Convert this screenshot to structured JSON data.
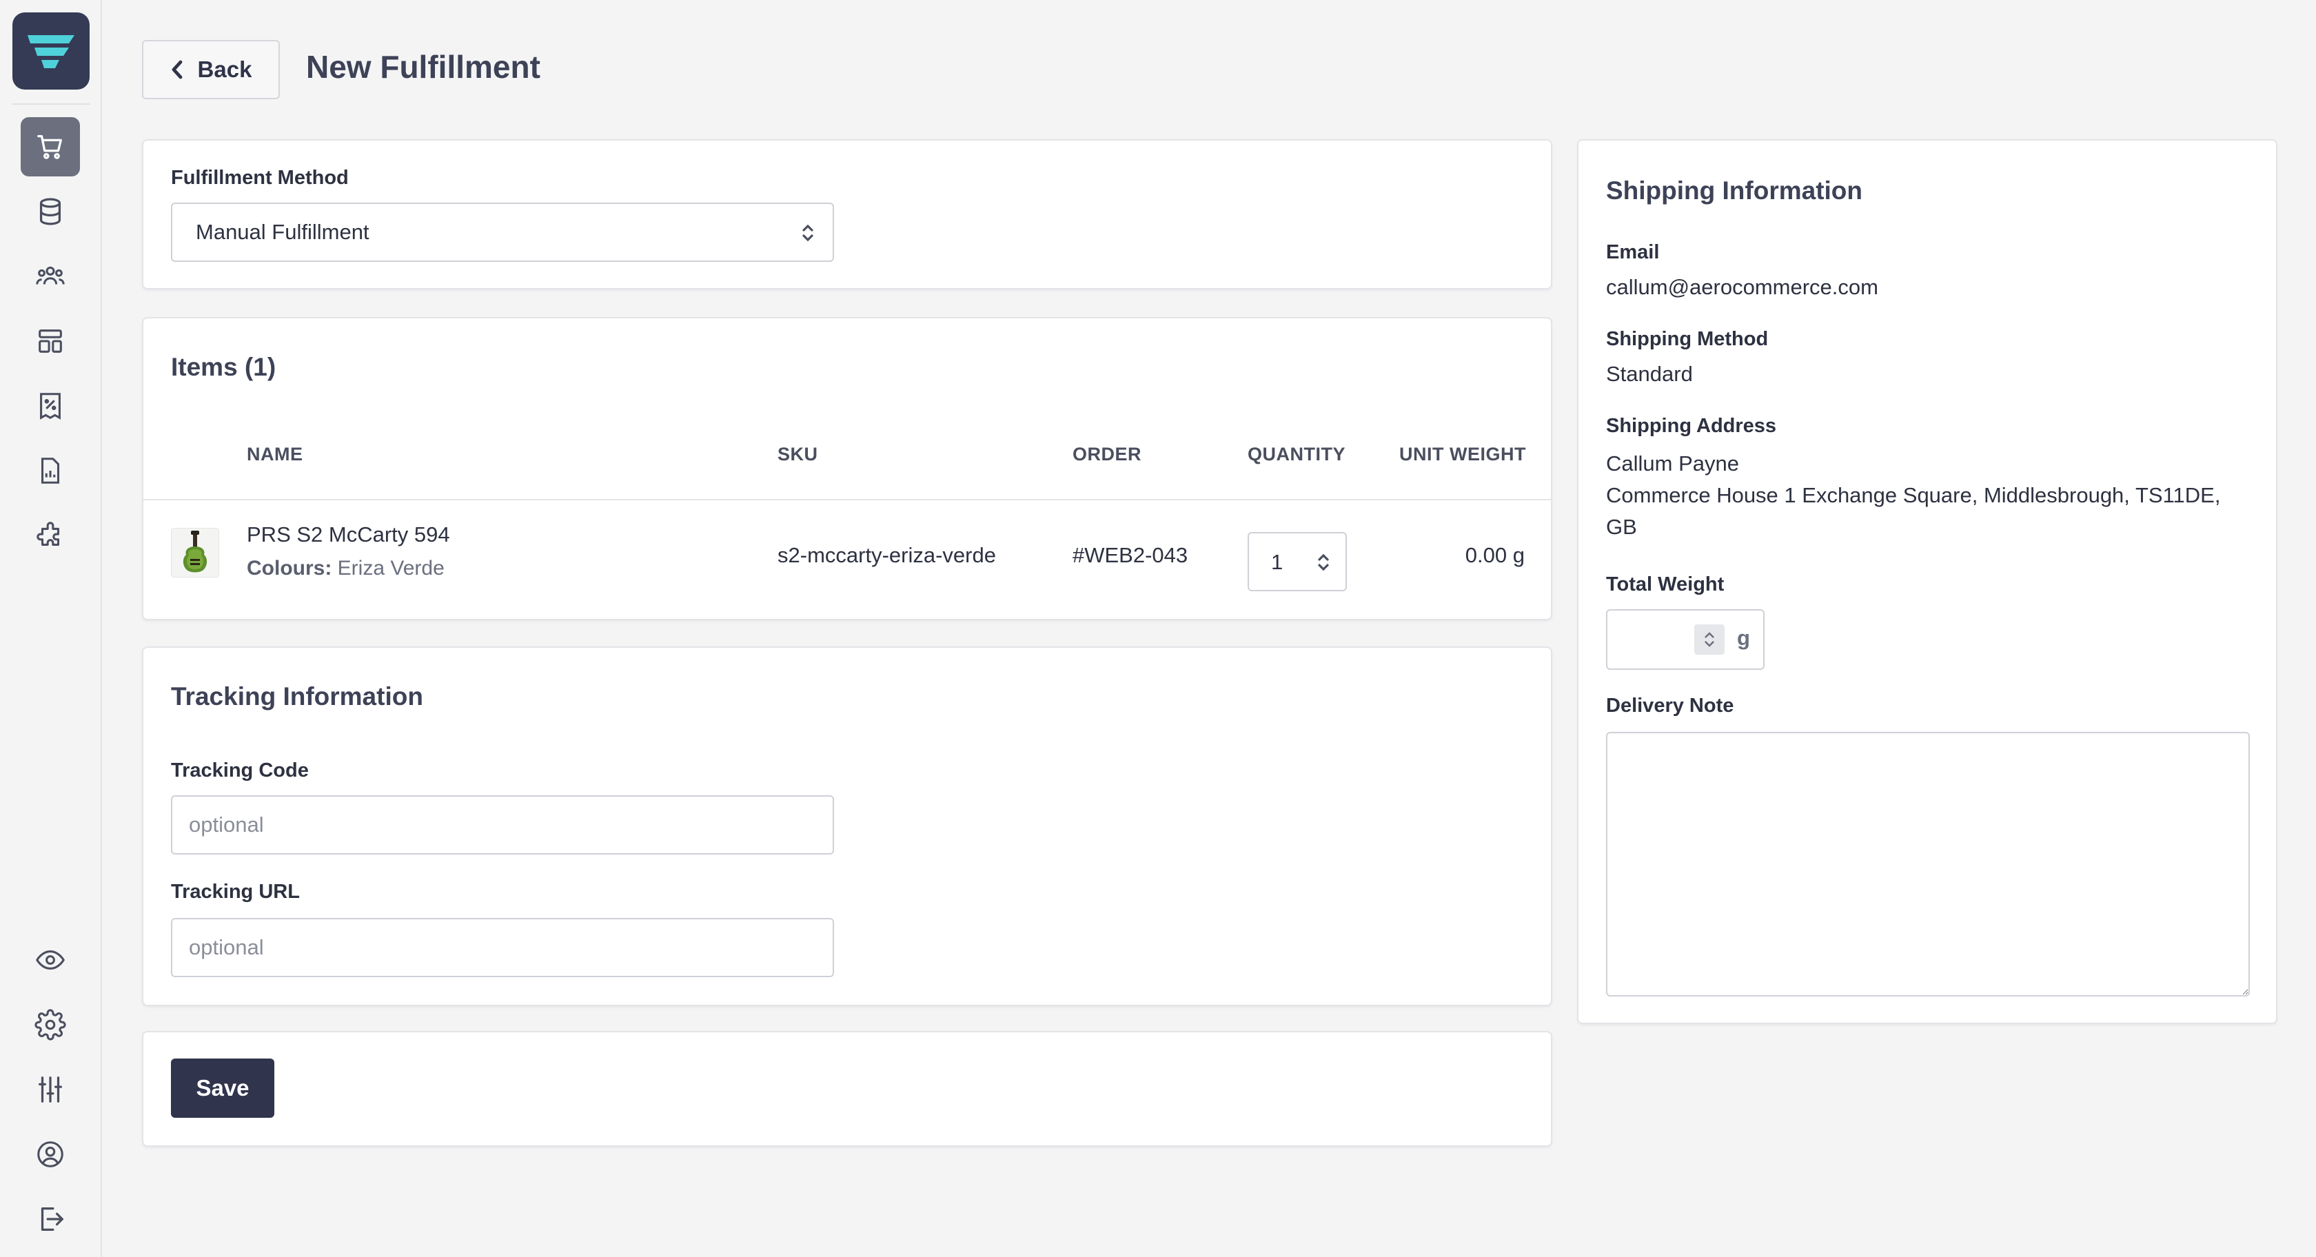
{
  "header": {
    "back_label": "Back",
    "title": "New Fulfillment"
  },
  "sidebar": {
    "items": [
      {
        "icon": "cart-icon",
        "active": true
      },
      {
        "icon": "database-icon"
      },
      {
        "icon": "users-icon"
      },
      {
        "icon": "layout-icon"
      },
      {
        "icon": "discount-icon"
      },
      {
        "icon": "reports-icon"
      },
      {
        "icon": "puzzle-icon"
      }
    ],
    "bottom_items": [
      {
        "icon": "eye-icon"
      },
      {
        "icon": "gear-icon"
      },
      {
        "icon": "sliders-icon"
      },
      {
        "icon": "account-icon"
      },
      {
        "icon": "logout-icon"
      }
    ]
  },
  "fulfillment": {
    "method_label": "Fulfillment Method",
    "method_value": "Manual Fulfillment"
  },
  "items": {
    "title": "Items (1)",
    "columns": [
      "NAME",
      "SKU",
      "ORDER",
      "QUANTITY",
      "UNIT WEIGHT"
    ],
    "rows": [
      {
        "name": "PRS S2 McCarty 594",
        "option_label": "Colours:",
        "option_value": "Eriza Verde",
        "sku": "s2-mccarty-eriza-verde",
        "order": "#WEB2-043",
        "quantity": "1",
        "unit_weight": "0.00 g"
      }
    ]
  },
  "tracking": {
    "title": "Tracking Information",
    "code_label": "Tracking Code",
    "code_placeholder": "optional",
    "url_label": "Tracking URL",
    "url_placeholder": "optional"
  },
  "actions": {
    "save_label": "Save"
  },
  "shipping": {
    "title": "Shipping Information",
    "email_label": "Email",
    "email_value": "callum@aerocommerce.com",
    "method_label": "Shipping Method",
    "method_value": "Standard",
    "address_label": "Shipping Address",
    "address_name": "Callum Payne",
    "address_line": "Commerce House 1 Exchange Square, Middlesbrough, TS11DE,",
    "address_country": "GB",
    "weight_label": "Total Weight",
    "weight_unit": "g",
    "note_label": "Delivery Note"
  },
  "colors": {
    "brand": "#353a55",
    "accent": "#4fd1d9",
    "save_button": "#30344d"
  }
}
